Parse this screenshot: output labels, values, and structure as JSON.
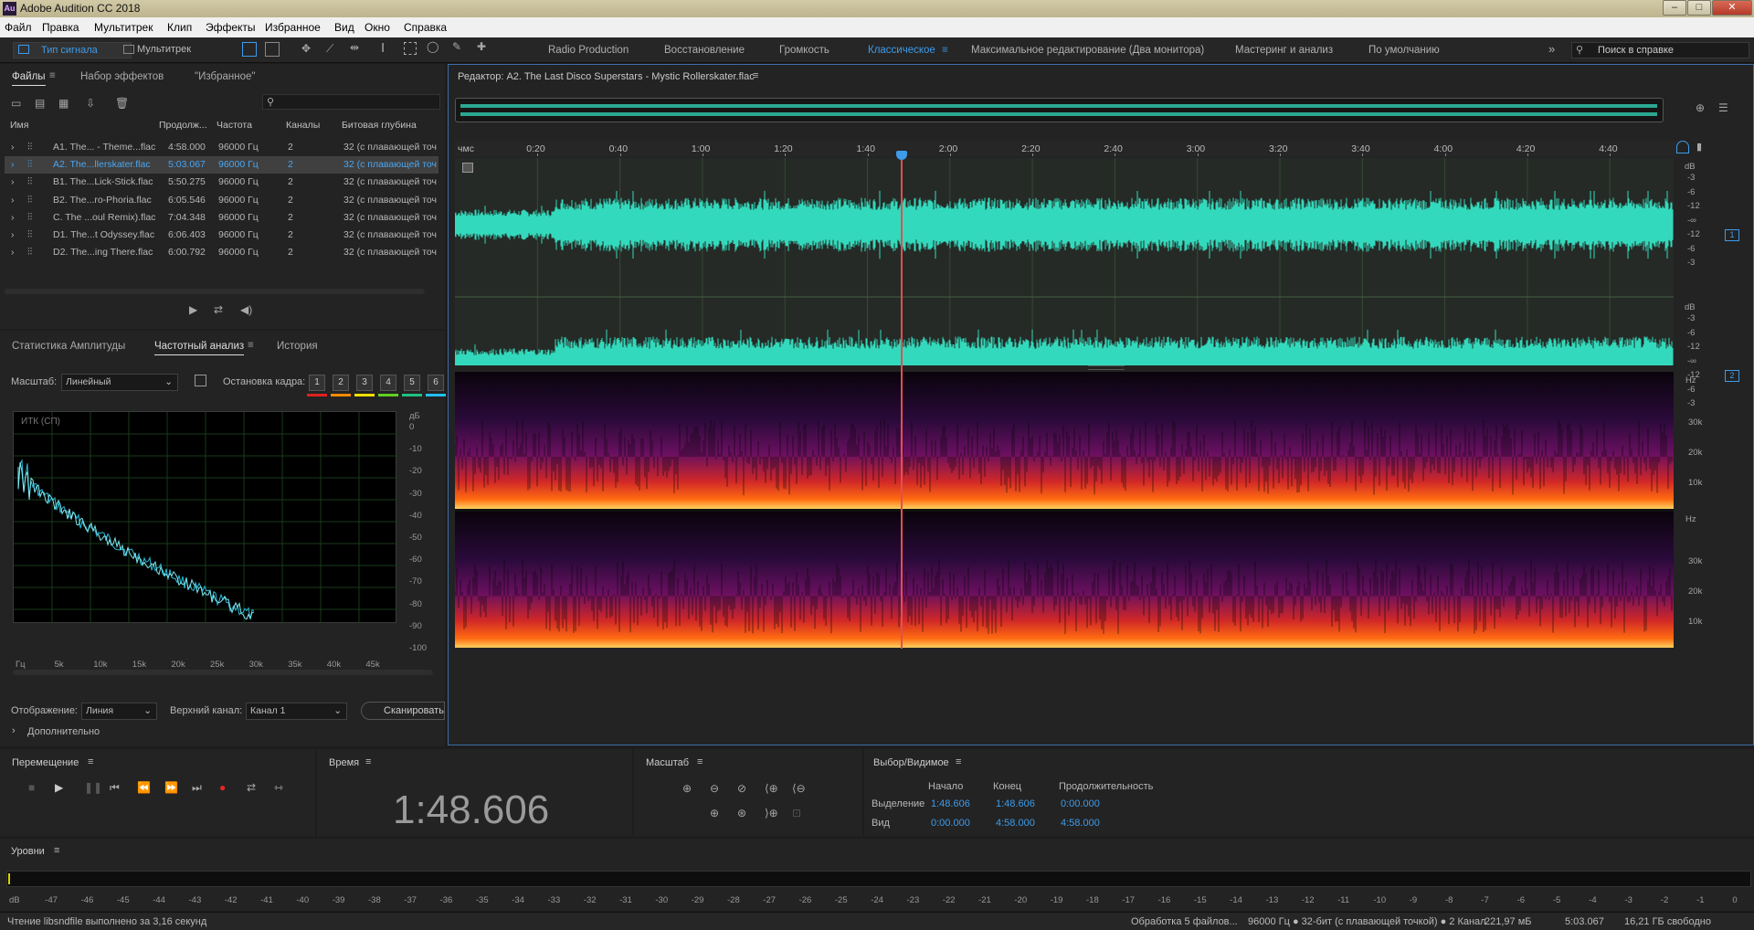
{
  "window": {
    "title": "Adobe Audition CC 2018",
    "logo": "Au"
  },
  "menu": [
    "Файл",
    "Правка",
    "Мультитрек",
    "Клип",
    "Эффекты",
    "Избранное",
    "Вид",
    "Окно",
    "Справка"
  ],
  "toolbar": {
    "waveform_label": "Тип сигнала",
    "multitrack_label": "Мультитрек",
    "workspaces": [
      "Radio Production",
      "Восстановление",
      "Громкость",
      "Классическое",
      "Максимальное редактирование (Два монитора)",
      "Мастеринг и анализ",
      "По умолчанию"
    ],
    "active_workspace": "Классическое",
    "help_search_placeholder": "Поиск в справке"
  },
  "files_panel": {
    "tabs": [
      "Файлы",
      "Набор эффектов",
      "\"Избранное\""
    ],
    "columns": [
      "Имя",
      "Продолж...",
      "Частота",
      "Каналы",
      "Битовая глубина"
    ],
    "rows": [
      {
        "name": "A1. The... - Theme...flac",
        "duration": "4:58.000",
        "rate": "96000 Гц",
        "channels": "2",
        "depth": "32 (с плавающей точ"
      },
      {
        "name": "A2. The...llerskater.flac",
        "duration": "5:03.067",
        "rate": "96000 Гц",
        "channels": "2",
        "depth": "32 (с плавающей точ",
        "selected": true
      },
      {
        "name": "B1. The...Lick-Stick.flac",
        "duration": "5:50.275",
        "rate": "96000 Гц",
        "channels": "2",
        "depth": "32 (с плавающей точ"
      },
      {
        "name": "B2. The...ro-Phoria.flac",
        "duration": "6:05.546",
        "rate": "96000 Гц",
        "channels": "2",
        "depth": "32 (с плавающей точ"
      },
      {
        "name": "C. The ...oul Remix).flac",
        "duration": "7:04.348",
        "rate": "96000 Гц",
        "channels": "2",
        "depth": "32 (с плавающей точ"
      },
      {
        "name": "D1. The...t Odyssey.flac",
        "duration": "6:06.403",
        "rate": "96000 Гц",
        "channels": "2",
        "depth": "32 (с плавающей точ"
      },
      {
        "name": "D2. The...ing There.flac",
        "duration": "6:00.792",
        "rate": "96000 Гц",
        "channels": "2",
        "depth": "32 (с плавающей точ"
      }
    ]
  },
  "analysis_panel": {
    "tabs": [
      "Статистика Амплитуды",
      "Частотный анализ",
      "История"
    ],
    "scale_label": "Масштаб:",
    "scale_value": "Линейный",
    "freeze_label": "Остановка кадра:",
    "freeze_slots": [
      "1",
      "2",
      "3",
      "4",
      "5",
      "6"
    ],
    "freeze_colors": [
      "#e02020",
      "#ff8a00",
      "#f0e000",
      "#60d020",
      "#20c080",
      "#20c0f0"
    ],
    "graph_title": "ИТК (СП)",
    "db_unit": "дБ",
    "db_ticks": [
      "0",
      "-10",
      "-20",
      "-30",
      "-40",
      "-50",
      "-60",
      "-70",
      "-80",
      "-90",
      "-100"
    ],
    "freq_ticks": [
      "Гц",
      "5k",
      "10k",
      "15k",
      "20k",
      "25k",
      "30k",
      "35k",
      "40k",
      "45k"
    ],
    "display_label": "Отображение:",
    "display_value": "Линия",
    "top_channel_label": "Верхний канал:",
    "top_channel_value": "Канал 1",
    "scan_button": "Сканировать",
    "advanced": "Дополнительно"
  },
  "editor": {
    "title": "Редактор: A2. The Last Disco Superstars - Mystic Rollerskater.flac",
    "time_unit": "чмс",
    "time_ticks": [
      "0:20",
      "0:40",
      "1:00",
      "1:20",
      "1:40",
      "2:00",
      "2:20",
      "2:40",
      "3:00",
      "3:20",
      "3:40",
      "4:00",
      "4:20",
      "4:40"
    ],
    "db_label": "dB",
    "db_ticks_ch": [
      "-3",
      "-6",
      "-12",
      "-∞",
      "-12",
      "-6",
      "-3"
    ],
    "channel_badges": [
      "1",
      "2"
    ],
    "hz_label": "Hz",
    "hz_ticks": [
      "30k",
      "20k",
      "10k"
    ],
    "playhead_time": "1:48.606"
  },
  "transport": {
    "title": "Перемещение"
  },
  "time_panel": {
    "title": "Время",
    "value": "1:48.606"
  },
  "zoom_panel": {
    "title": "Масштаб"
  },
  "selection_panel": {
    "title": "Выбор/Видимое",
    "headers": [
      "Начало",
      "Конец",
      "Продолжительность"
    ],
    "selection_label": "Выделение",
    "selection": [
      "1:48.606",
      "1:48.606",
      "0:00.000"
    ],
    "view_label": "Вид",
    "view": [
      "0:00.000",
      "4:58.000",
      "4:58.000"
    ]
  },
  "levels_panel": {
    "title": "Уровни",
    "ticks": [
      "dB",
      "-47",
      "-46",
      "-45",
      "-44",
      "-43",
      "-42",
      "-41",
      "-40",
      "-39",
      "-38",
      "-37",
      "-36",
      "-35",
      "-34",
      "-33",
      "-32",
      "-31",
      "-30",
      "-29",
      "-28",
      "-27",
      "-26",
      "-25",
      "-24",
      "-23",
      "-22",
      "-21",
      "-20",
      "-19",
      "-18",
      "-17",
      "-16",
      "-15",
      "-14",
      "-13",
      "-12",
      "-11",
      "-10",
      "-9",
      "-8",
      "-7",
      "-6",
      "-5",
      "-4",
      "-3",
      "-2",
      "-1",
      "0"
    ]
  },
  "status": {
    "left": "Чтение libsndfile выполнено за 3,16 секунд",
    "processing": "Обработка 5 файлов...",
    "format": "96000 Гц ● 32-бит (с плавающей точкой) ● 2 Канал",
    "size": "221,97 мБ",
    "duration": "5:03.067",
    "free": "16,21 ГБ свободно"
  },
  "colors": {
    "accent": "#3d9bea",
    "waveform": "#33d9bc",
    "playhead": "#e05050",
    "background": "#232323"
  }
}
